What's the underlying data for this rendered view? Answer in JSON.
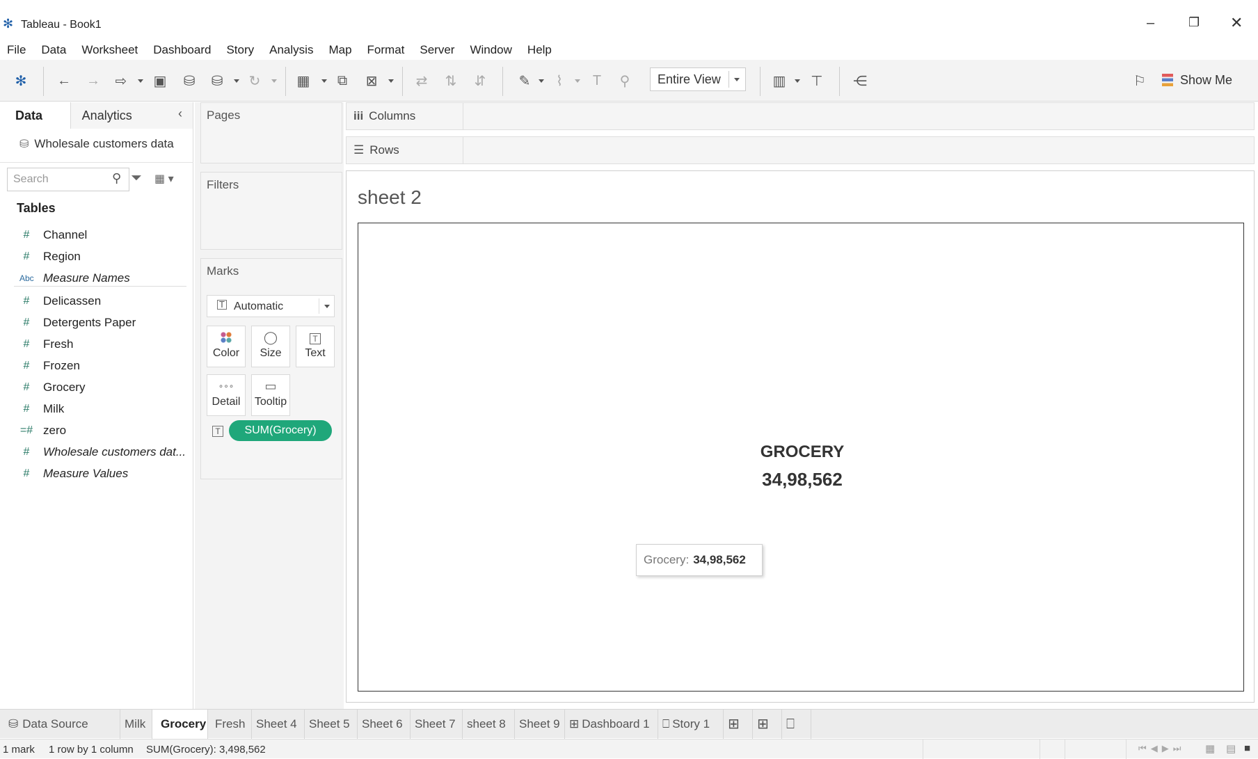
{
  "window": {
    "title": "Tableau - Book1"
  },
  "menu": [
    "File",
    "Data",
    "Worksheet",
    "Dashboard",
    "Story",
    "Analysis",
    "Map",
    "Format",
    "Server",
    "Window",
    "Help"
  ],
  "toolbar": {
    "fit_select": "Entire View",
    "show_me": "Show Me"
  },
  "left_pane": {
    "tabs": [
      "Data",
      "Analytics"
    ],
    "datasource": "Wholesale customers data",
    "search_placeholder": "Search",
    "tables_heading": "Tables",
    "fields": [
      {
        "type": "#",
        "name": "Channel",
        "italic": false
      },
      {
        "type": "#",
        "name": "Region",
        "italic": false
      },
      {
        "type": "Abc",
        "name": "Measure Names",
        "italic": true
      },
      {
        "type": "#",
        "name": "Delicassen",
        "italic": false
      },
      {
        "type": "#",
        "name": "Detergents Paper",
        "italic": false
      },
      {
        "type": "#",
        "name": "Fresh",
        "italic": false
      },
      {
        "type": "#",
        "name": "Frozen",
        "italic": false
      },
      {
        "type": "#",
        "name": "Grocery",
        "italic": false
      },
      {
        "type": "#",
        "name": "Milk",
        "italic": false
      },
      {
        "type": "=#",
        "name": "zero",
        "italic": false
      },
      {
        "type": "#",
        "name": "Wholesale customers dat...",
        "italic": true
      },
      {
        "type": "#",
        "name": "Measure Values",
        "italic": true
      }
    ]
  },
  "cards": {
    "pages": "Pages",
    "filters": "Filters",
    "marks": "Marks",
    "mark_type": "Automatic",
    "buttons": [
      "Color",
      "Size",
      "Text",
      "Detail",
      "Tooltip"
    ],
    "pill": "SUM(Grocery)"
  },
  "shelves": {
    "columns": "Columns",
    "rows": "Rows"
  },
  "sheet": {
    "title": "sheet 2",
    "label": "GROCERY",
    "value": "34,98,562",
    "tooltip_label": "Grocery:",
    "tooltip_value": "34,98,562"
  },
  "bottom_tabs": [
    "Data Source",
    "Milk",
    "Grocery",
    "Fresh",
    "Sheet 4",
    "Sheet 5",
    "Sheet 6",
    "Sheet 7",
    "sheet 8",
    "Sheet 9",
    "Dashboard 1",
    "Story 1"
  ],
  "active_tab": "Grocery",
  "status": {
    "marks": "1 mark",
    "dims": "1 row by 1 column",
    "sum": "SUM(Grocery): 3,498,562"
  },
  "colors": {
    "pill": "#1fa77a",
    "field_icon": "#2e7d6a",
    "logo_blue": "#1f5fa8"
  }
}
